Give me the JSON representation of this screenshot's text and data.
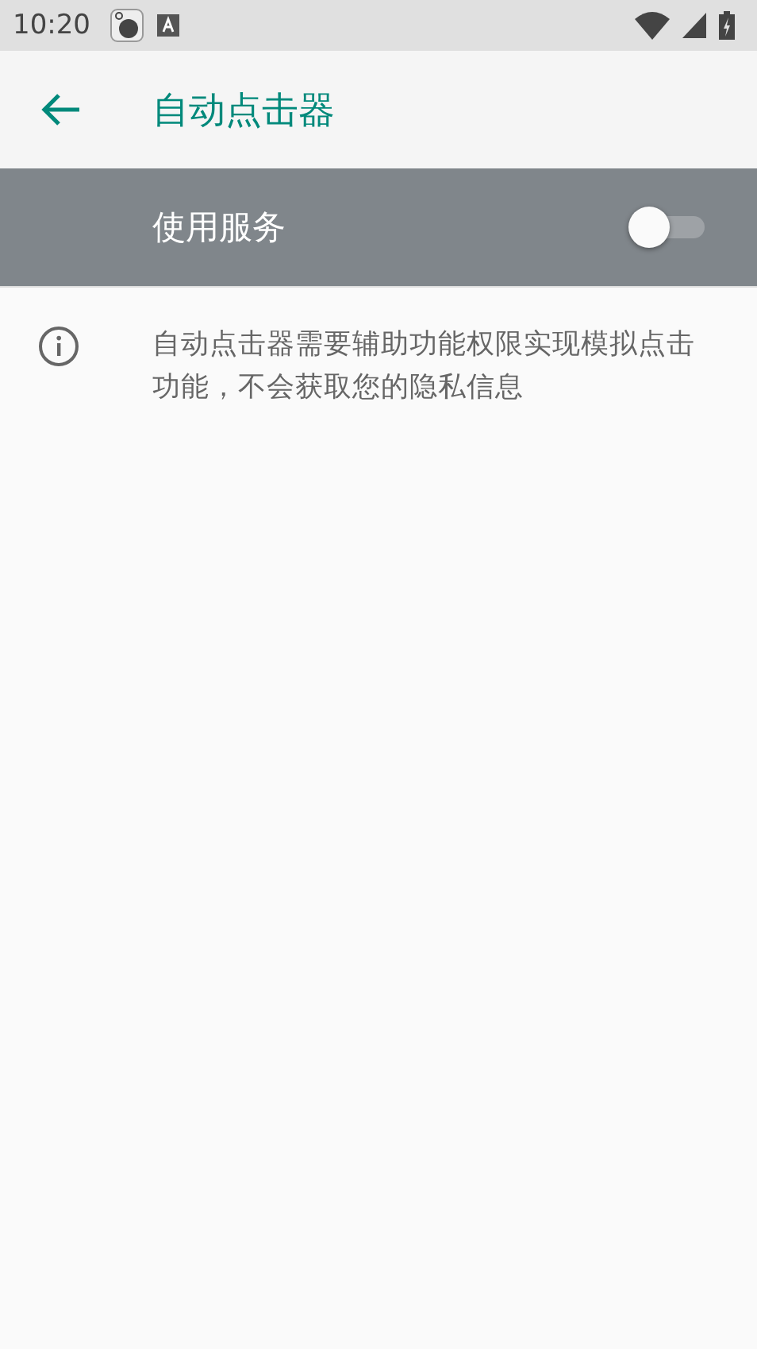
{
  "status_bar": {
    "time": "10:20"
  },
  "app_bar": {
    "title": "自动点击器"
  },
  "service_switch": {
    "label": "使用服务",
    "on": false
  },
  "info": {
    "text": "自动点击器需要辅助功能权限实现模拟点击功能，不会获取您的隐私信息"
  }
}
